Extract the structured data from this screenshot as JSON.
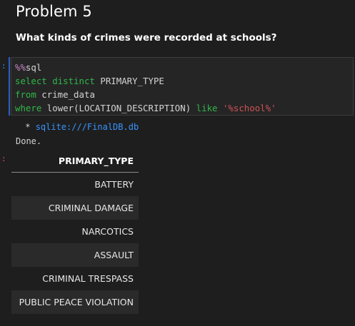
{
  "markdown": {
    "heading": "Problem 5",
    "question": "What kinds of crimes were recorded at schools?"
  },
  "prompts": {
    "input": ":",
    "output": ":"
  },
  "code": {
    "magic": "%%",
    "magic_word": "sql",
    "line2_kw": "select distinct",
    "line2_rest": " PRIMARY_TYPE",
    "line3_kw": "from",
    "line3_rest": " crime_data",
    "line4_kw": "where",
    "line4_mid": " lower(LOCATION_DESCRIPTION) ",
    "line4_kw2": "like",
    "line4_space": " ",
    "line4_str": "'%school%'"
  },
  "output": {
    "conn_prefix": " * ",
    "conn_url": "sqlite:///FinalDB.db",
    "done": "Done."
  },
  "table": {
    "header": "PRIMARY_TYPE",
    "rows": [
      "BATTERY",
      "CRIMINAL DAMAGE",
      "NARCOTICS",
      "ASSAULT",
      "CRIMINAL TRESPASS",
      "PUBLIC PEACE VIOLATION"
    ]
  }
}
